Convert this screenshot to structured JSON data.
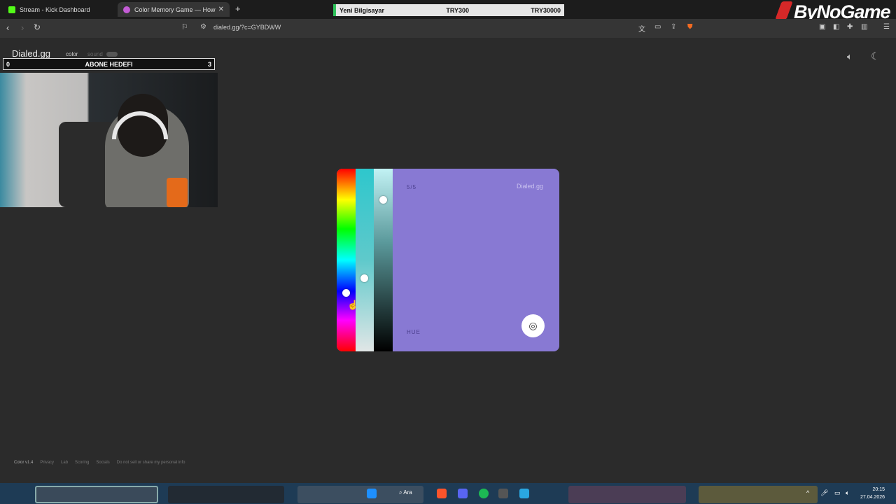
{
  "tabs": [
    {
      "label": "Stream - Kick Dashboard",
      "favicon_color": "#53fc18"
    },
    {
      "label": "Color Memory Game — How",
      "favicon_color": "#c45cd6"
    }
  ],
  "new_tab_icon": "+",
  "donation_bar": {
    "label": "Yeni Bilgisayar",
    "current": "TRY300",
    "target": "TRY30000"
  },
  "overlay_logo": "ByNoGame",
  "address_bar": {
    "url": "dialed.gg/?c=GYBDWW"
  },
  "site": {
    "brand": "Dialed.gg",
    "nav_color": "color",
    "nav_sound": "sound"
  },
  "sub_goal": {
    "start": "0",
    "label": "ABONE HEDEFI",
    "end": "3"
  },
  "game": {
    "round": "5/5",
    "brand": "Dialed.gg",
    "hint": "HUE",
    "target_color": "#8879d3",
    "hue_level": 0.68,
    "sat_level": 0.6,
    "lum_level": 0.17
  },
  "footer": {
    "links": [
      "Color v1.4",
      "Privacy",
      "Lab",
      "Scoring",
      "Socials",
      "Do not sell or share my personal info"
    ]
  },
  "taskbar": {
    "search_label": "Ara",
    "clock_time": "20:15",
    "clock_date": "27.04.2026"
  }
}
